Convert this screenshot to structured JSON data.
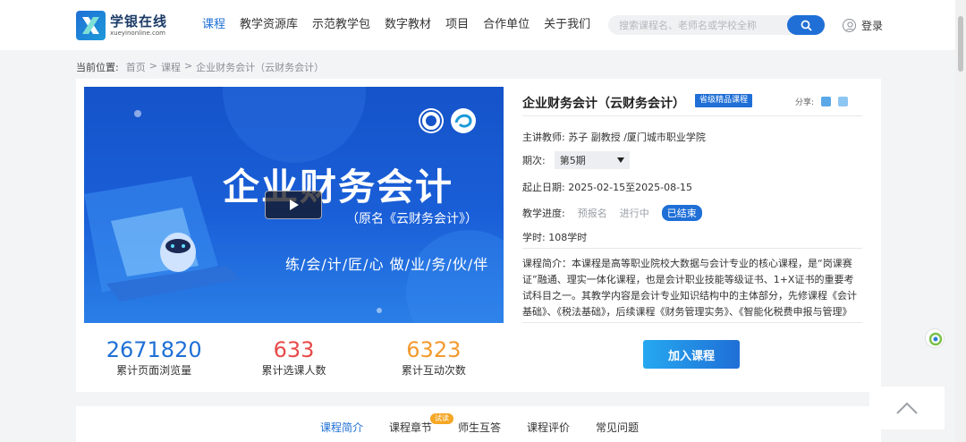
{
  "header": {
    "logo_cn": "学银在线",
    "logo_en": "xueyinonline.com",
    "nav": [
      "课程",
      "教学资源库",
      "示范教学包",
      "数字教材",
      "项目",
      "合作单位",
      "关于我们"
    ],
    "search_placeholder": "搜索课程名、老师名或学校全称",
    "login_label": "登录"
  },
  "breadcrumb": {
    "label": "当前位置:",
    "items": [
      "首页",
      "课程",
      "企业财务会计（云财务会计）"
    ]
  },
  "cover": {
    "title": "企业财务会计",
    "subtitle": "（原名《云财务会计》）",
    "slogan": "练/会/计/匠/心 做/业/务/伙/伴"
  },
  "stats": [
    {
      "value": "2671820",
      "label": "累计页面浏览量",
      "color": "#1f6fd6"
    },
    {
      "value": "633",
      "label": "累计选课人数",
      "color": "#e84a4a"
    },
    {
      "value": "6323",
      "label": "累计互动次数",
      "color": "#f29a2e"
    }
  ],
  "course": {
    "title": "企业财务会计（云财务会计）",
    "badge": "省级精品课程",
    "share_label": "分享:",
    "teacher": "主讲教师: 苏子 副教授 /厦门城市职业学院",
    "period_label": "期次:",
    "period_value": "第5期",
    "dates": "起止日期: 2025-02-15至2025-08-15",
    "progress_label": "教学进度:",
    "progress_steps": [
      "预报名",
      "进行中",
      "已结束"
    ],
    "hours": "学时: 108学时",
    "intro": "课程简介：本课程是高等职业院校大数据与会计专业的核心课程，是“岗课赛证”融通、理实一体化课程，也是会计职业技能等级证书、1+X证书的重要考试科目之一。其教学内容是会计专业知识结构中的主体部分，先修课程《会计基础》、《税法基础》，后续课程《财务管理实务》、《智能化税费申报与管理》等。该课程坚持德才兼备的...",
    "join_label": "加入课程"
  },
  "tabs": {
    "items": [
      "课程简介",
      "课程章节",
      "师生互答",
      "课程评价",
      "常见问题"
    ],
    "try_tag": "试读"
  }
}
